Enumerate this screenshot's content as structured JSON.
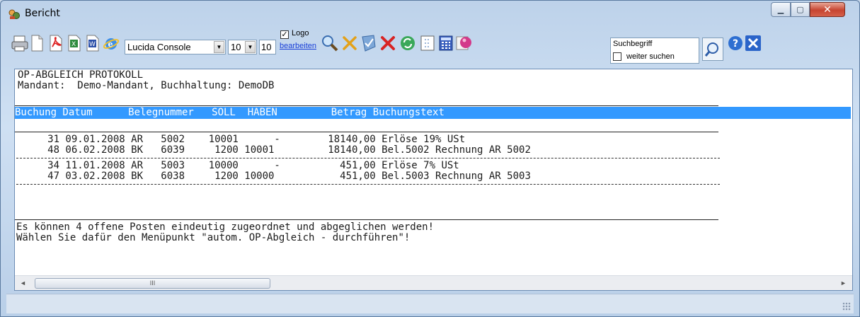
{
  "window": {
    "title": "Bericht",
    "icon": "report-app-icon",
    "controls": [
      "minimize-icon",
      "maximize-icon",
      "close-icon"
    ]
  },
  "toolbar": {
    "icons": [
      "print-icon",
      "new-page-icon",
      "pdf-export-icon",
      "excel-export-icon",
      "word-export-icon",
      "internet-explorer-icon"
    ],
    "font_family": "Lucida Console",
    "font_size": "10",
    "font_size_spin": "10",
    "logo_checkbox_label": "Logo",
    "logo_checked": true,
    "logo_edit_link": "bearbeiten",
    "action_icons": [
      "zoom-icon",
      "cross-mark-icon",
      "shield-check-icon",
      "red-x-icon",
      "refresh-icon",
      "page-setup-icon",
      "calculator-icon",
      "settings-sphere-icon"
    ],
    "search_placeholder": "Suchbegriff",
    "search_continue_label": "weiter suchen",
    "search_continue_checked": false,
    "end_icons": [
      "search-button-icon",
      "help-icon",
      "close-report-icon"
    ]
  },
  "report": {
    "title": "OP-ABGLEICH PROTOKOLL",
    "mandant_line": "Mandant:  Demo-Mandant, Buchhaltung: DemoDB",
    "columns": [
      "Buchung",
      "Datum",
      "Belegnummer",
      "SOLL",
      "HABEN",
      "Betrag",
      "Buchungstext"
    ],
    "header_line": "Buchung Datum      Belegnummer   SOLL  HABEN         Betrag Buchungstext",
    "groups": [
      {
        "rows": [
          {
            "buchung": "31",
            "datum": "09.01.2008",
            "art": "AR",
            "beleg": "5002",
            "soll": "10001",
            "haben": "-",
            "betrag": "18140,00",
            "text": "Erlöse 19% USt"
          },
          {
            "buchung": "48",
            "datum": "06.02.2008",
            "art": "BK",
            "beleg": "6039",
            "soll": "1200",
            "haben": "10001",
            "betrag": "18140,00",
            "text": "Bel.5002 Rechnung AR 5002"
          }
        ],
        "lines": [
          "     31 09.01.2008 AR   5002    10001      -        18140,00 Erlöse 19% USt",
          "     48 06.02.2008 BK   6039     1200 10001         18140,00 Bel.5002 Rechnung AR 5002"
        ]
      },
      {
        "rows": [
          {
            "buchung": "34",
            "datum": "11.01.2008",
            "art": "AR",
            "beleg": "5003",
            "soll": "10000",
            "haben": "-",
            "betrag": "451,00",
            "text": "Erlöse 7% USt"
          },
          {
            "buchung": "47",
            "datum": "03.02.2008",
            "art": "BK",
            "beleg": "6038",
            "soll": "1200",
            "haben": "10000",
            "betrag": "451,00",
            "text": "Bel.5003 Rechnung AR 5003"
          }
        ],
        "lines": [
          "     34 11.01.2008 AR   5003    10000      -          451,00 Erlöse 7% USt",
          "     47 03.02.2008 BK   6038     1200 10000           451,00 Bel.5003 Rechnung AR 5003"
        ]
      }
    ],
    "footer_line1": "Es können 4 offene Posten eindeutig zugeordnet und abgeglichen werden!",
    "footer_line2": "Wählen Sie dafür den Menüpunkt \"autom. OP-Abgleich - durchführen\"!"
  },
  "scrollbar": {
    "left_arrow": "◄",
    "right_arrow": "►",
    "thumb_grip": "III"
  }
}
